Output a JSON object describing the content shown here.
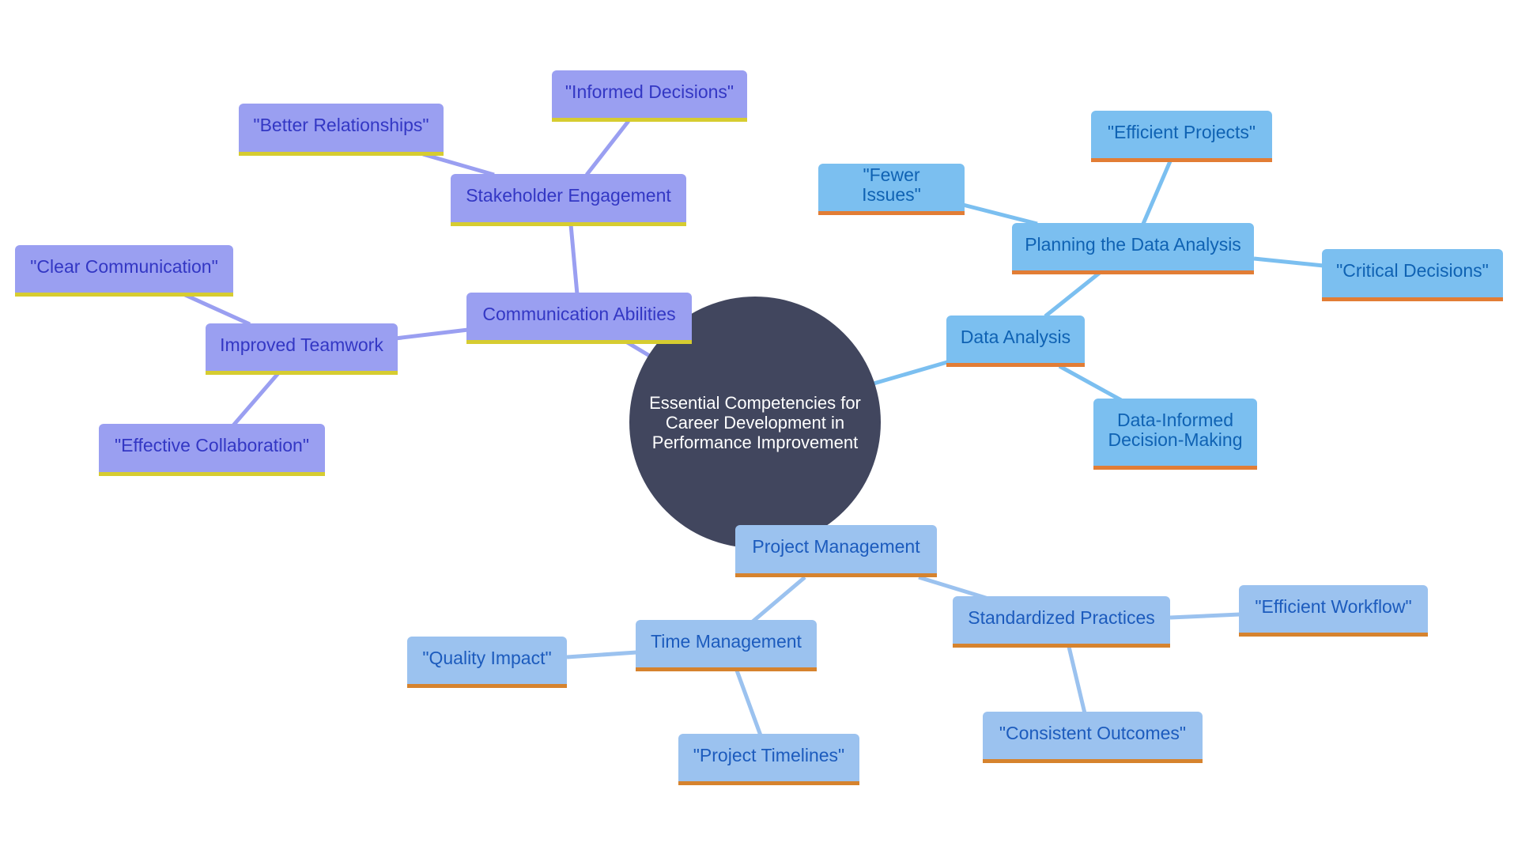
{
  "root": {
    "label_lines": [
      "Essential Competencies for",
      "Career Development in",
      "Performance Improvement"
    ],
    "color": "#41465e"
  },
  "branches": [
    {
      "label": "Communication Abilities",
      "color_scheme": "purple",
      "children": [
        {
          "label": "Stakeholder Engagement",
          "children": [
            {
              "label": "\"Better Relationships\""
            },
            {
              "label": "\"Informed Decisions\""
            }
          ]
        },
        {
          "label": "Improved Teamwork",
          "children": [
            {
              "label": "\"Clear Communication\""
            },
            {
              "label": "\"Effective Collaboration\""
            }
          ]
        }
      ]
    },
    {
      "label": "Data Analysis",
      "color_scheme": "sky",
      "children": [
        {
          "label": "Planning the Data Analysis",
          "children": [
            {
              "label": "\"Fewer Issues\""
            },
            {
              "label": "\"Efficient Projects\""
            },
            {
              "label": "\"Critical Decisions\""
            }
          ]
        },
        {
          "label_lines": [
            "Data-Informed",
            "Decision-Making"
          ]
        }
      ]
    },
    {
      "label": "Project Management",
      "color_scheme": "lightblue",
      "children": [
        {
          "label": "Time Management",
          "children": [
            {
              "label": "\"Quality Impact\""
            },
            {
              "label": "\"Project Timelines\""
            }
          ]
        },
        {
          "label": "Standardized Practices",
          "children": [
            {
              "label": "\"Efficient Workflow\""
            },
            {
              "label": "\"Consistent Outcomes\""
            }
          ]
        }
      ]
    }
  ],
  "colors": {
    "purple": {
      "fill": "#9a9ff1",
      "text": "#3337c4",
      "underline": "#d6cc30",
      "edge": "#9a9ff1"
    },
    "sky": {
      "fill": "#7bbff0",
      "text": "#0f62b3",
      "underline": "#e27d35",
      "edge": "#7bbff0"
    },
    "lightblue": {
      "fill": "#9bc2ef",
      "text": "#1c5bbd",
      "underline": "#d6832e",
      "edge": "#9bc2ef"
    }
  }
}
